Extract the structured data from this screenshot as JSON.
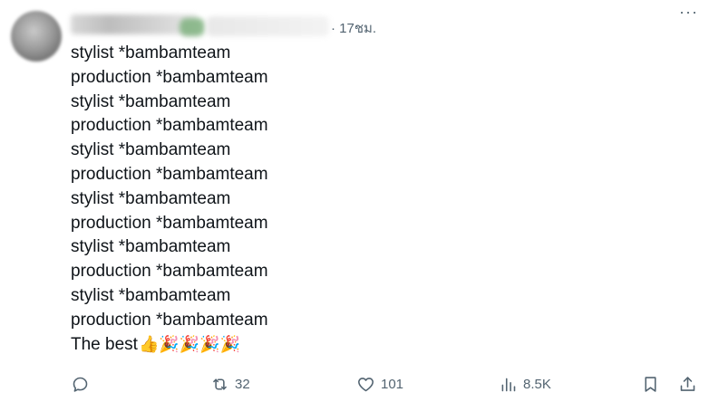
{
  "post": {
    "time": "· 17ชม.",
    "more_label": "···",
    "lines": [
      "stylist *bambamteam",
      "production *bambamteam",
      "stylist *bambamteam",
      "production *bambamteam",
      "stylist *bambamteam",
      "production *bambamteam",
      "stylist *bambamteam",
      "production *bambamteam",
      "stylist *bambamteam",
      "production *bambamteam",
      "stylist *bambamteam",
      "production *bambamteam"
    ],
    "last_line_text": "The best",
    "last_line_emojis": "👍🎉🎉🎉🎉"
  },
  "actions": {
    "reply_count": "",
    "repost_count": "32",
    "like_count": "101",
    "views_count": "8.5K"
  },
  "icons": {
    "reply": "reply-icon",
    "repost": "repost-icon",
    "like": "heart-icon",
    "views": "views-chart-icon",
    "bookmark": "bookmark-icon",
    "share": "share-icon",
    "more": "more-icon"
  },
  "colors": {
    "text": "#0f1419",
    "muted": "#536471",
    "background": "#ffffff"
  }
}
